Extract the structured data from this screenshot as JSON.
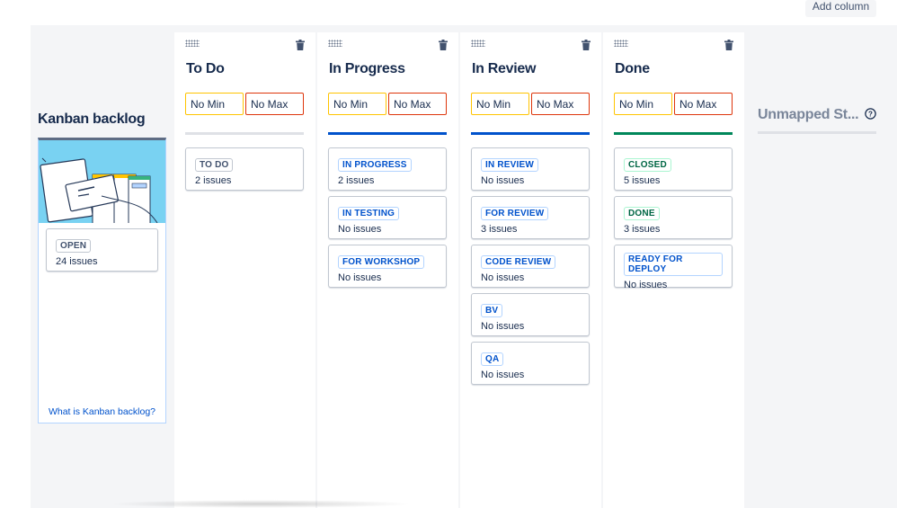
{
  "toolbar": {
    "add_column_label": "Add column"
  },
  "backlog": {
    "title": "Kanban backlog",
    "card": {
      "status": "OPEN",
      "count": "24 issues"
    },
    "link": "What is Kanban backlog?"
  },
  "columns": [
    {
      "title": "To Do",
      "min": "No Min",
      "max": "No Max",
      "bar_color": "#dfe1e6",
      "statuses": [
        {
          "label": "TO DO",
          "count": "2 issues",
          "tone": "gray"
        }
      ]
    },
    {
      "title": "In Progress",
      "min": "No Min",
      "max": "No Max",
      "bar_color": "#0052cc",
      "statuses": [
        {
          "label": "IN PROGRESS",
          "count": "2 issues",
          "tone": "blue"
        },
        {
          "label": "IN TESTING",
          "count": "No issues",
          "tone": "blue"
        },
        {
          "label": "FOR WORKSHOP",
          "count": "No issues",
          "tone": "blue"
        }
      ]
    },
    {
      "title": "In Review",
      "min": "No Min",
      "max": "No Max",
      "bar_color": "#0052cc",
      "statuses": [
        {
          "label": "IN REVIEW",
          "count": "No issues",
          "tone": "blue"
        },
        {
          "label": "FOR REVIEW",
          "count": "3 issues",
          "tone": "blue"
        },
        {
          "label": "CODE REVIEW",
          "count": "No issues",
          "tone": "blue"
        },
        {
          "label": "BV",
          "count": "No issues",
          "tone": "blue"
        },
        {
          "label": "QA",
          "count": "No issues",
          "tone": "blue"
        }
      ]
    },
    {
      "title": "Done",
      "min": "No Min",
      "max": "No Max",
      "bar_color": "#00875a",
      "statuses": [
        {
          "label": "CLOSED",
          "count": "5 issues",
          "tone": "green"
        },
        {
          "label": "DONE",
          "count": "3 issues",
          "tone": "green"
        },
        {
          "label": "READY FOR DEPLOY",
          "count": "No issues",
          "tone": "blue"
        }
      ]
    }
  ],
  "unmapped": {
    "title": "Unmapped St..."
  },
  "icons": {
    "drag_handle": "grip-icon",
    "delete": "trash-icon",
    "help": "help-icon"
  }
}
